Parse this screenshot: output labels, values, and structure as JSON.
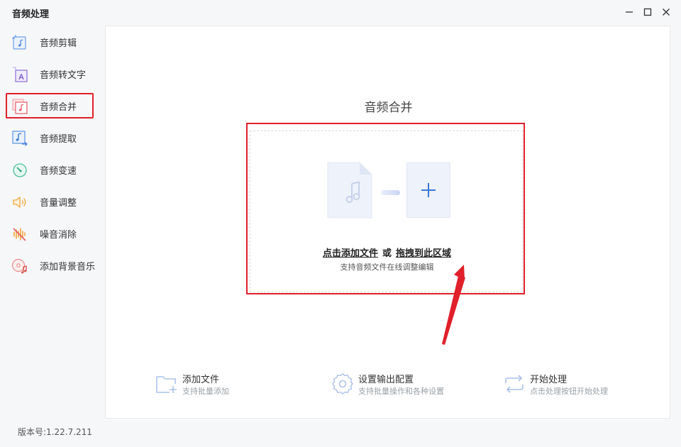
{
  "window": {
    "title": "音频处理"
  },
  "sidebar": {
    "items": [
      {
        "label": "音频剪辑",
        "icon": "audio-cut-icon"
      },
      {
        "label": "音频转文字",
        "icon": "audio-to-text-icon"
      },
      {
        "label": "音频合并",
        "icon": "audio-merge-icon",
        "active": true
      },
      {
        "label": "音频提取",
        "icon": "audio-extract-icon"
      },
      {
        "label": "音频变速",
        "icon": "audio-speed-icon"
      },
      {
        "label": "音量调整",
        "icon": "volume-icon"
      },
      {
        "label": "噪音消除",
        "icon": "noise-reduce-icon"
      },
      {
        "label": "添加背景音乐",
        "icon": "background-music-icon"
      }
    ]
  },
  "version": "版本号:1.22.7.211",
  "main": {
    "title": "音频合并",
    "drop": {
      "click_label": "点击添加文件",
      "or_label": "或",
      "drag_label": "拖拽到此区域",
      "subtitle": "支持音频文件在线调整编辑"
    },
    "features": [
      {
        "title": "添加文件",
        "subtitle": "支持批量添加",
        "icon": "add-folder-icon"
      },
      {
        "title": "设置输出配置",
        "subtitle": "支持批量操作和各种设置",
        "icon": "gear-icon"
      },
      {
        "title": "开始处理",
        "subtitle": "点击处理按钮开始处理",
        "icon": "cycle-icon"
      }
    ]
  },
  "colors": {
    "highlight_red": "#e0202a",
    "accent_blue": "#3a78d8",
    "placeholder_blue": "#eef2fb"
  }
}
